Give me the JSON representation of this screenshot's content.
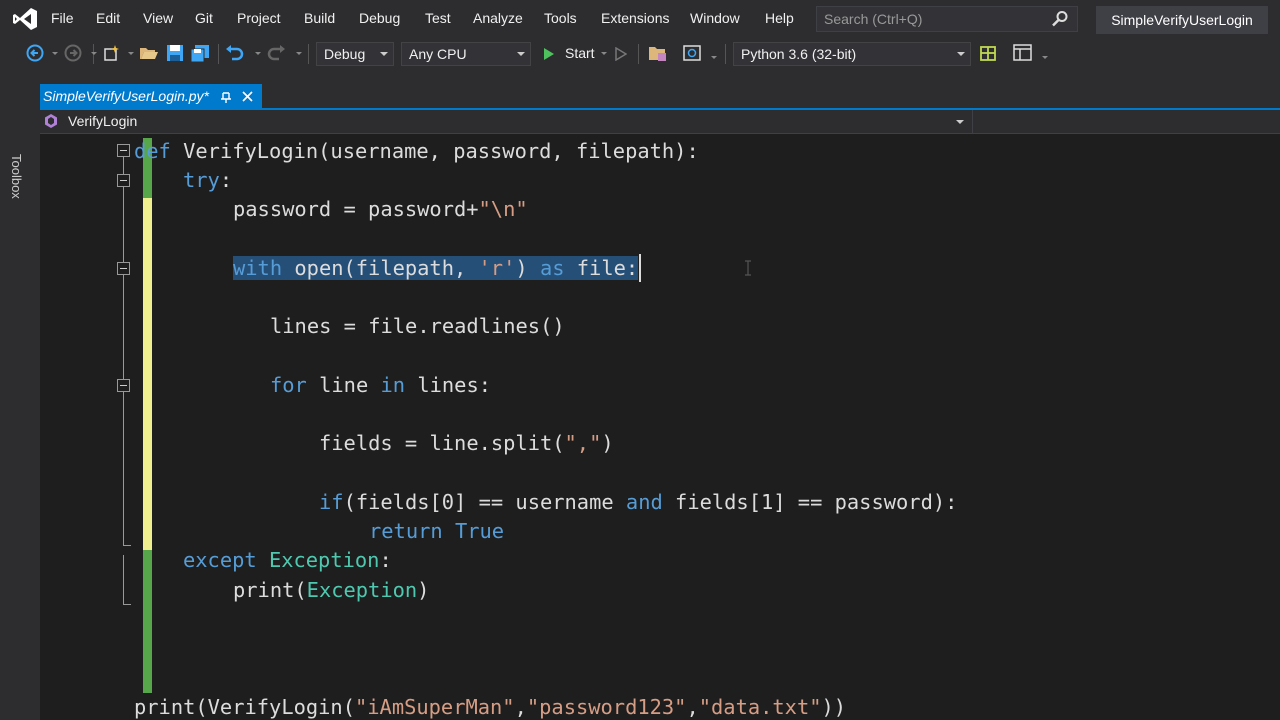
{
  "menu": {
    "items": [
      "File",
      "Edit",
      "View",
      "Git",
      "Project",
      "Build",
      "Debug",
      "Test",
      "Analyze",
      "Tools",
      "Extensions",
      "Window",
      "Help"
    ],
    "search_placeholder": "Search (Ctrl+Q)",
    "solution_title": "SimpleVerifyUserLogin"
  },
  "toolbar": {
    "configuration": "Debug",
    "platform": "Any CPU",
    "start_label": "Start",
    "environment": "Python 3.6 (32-bit)"
  },
  "side_panel": {
    "toolbox_label": "Toolbox"
  },
  "tab": {
    "filename": "SimpleVerifyUserLogin.py*"
  },
  "navbar": {
    "selected": "VerifyLogin"
  },
  "code": {
    "def_kw": "def",
    "def_rest": " VerifyLogin(username, password, filepath):",
    "try_kw": "try",
    "try_rest": ":",
    "assign": "password = password+",
    "assign_str": "\"\\n\"",
    "with_kw": "with",
    "with_1": " open(filepath, ",
    "with_str": "'r'",
    "with_2": ") ",
    "as_kw": "as",
    "with_3": " file:",
    "lines_line": "lines = file.readlines()",
    "for_kw": "for",
    "for_1": " line ",
    "in_kw": "in",
    "for_2": " lines:",
    "fields_1": "fields = line.split(",
    "fields_str": "\",\"",
    "fields_2": ")",
    "if_kw": "if",
    "if_1": "(fields[0] == username ",
    "and_kw": "and",
    "if_2": " fields[1] == password):",
    "return_kw": "return",
    "true_kw": "True",
    "except_kw": "except",
    "exception_cls": "Exception",
    "except_rest": ":",
    "print_1": "print(",
    "print_cls": "Exception",
    "print_2": ")",
    "final_1": "print(VerifyLogin(",
    "final_s1": "\"iAmSuperMan\"",
    "comma": ",",
    "final_s2": "\"password123\"",
    "final_s3": "\"data.txt\"",
    "final_2": "))"
  },
  "colors": {
    "keyword": "#569cd6",
    "string": "#d69d85",
    "class": "#4ec9b0",
    "selection": "#264f78",
    "accent": "#007acc"
  }
}
